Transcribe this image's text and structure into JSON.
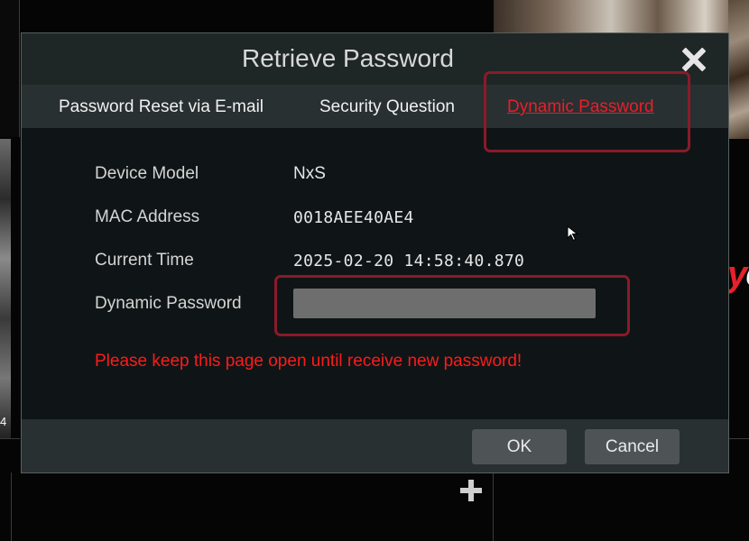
{
  "background": {
    "side_number": "4",
    "brand_fragment_red": "y",
    "brand_fragment_white": "c"
  },
  "dialog": {
    "title": "Retrieve Password",
    "tabs": [
      {
        "label": "Password Reset via E-mail",
        "active": false
      },
      {
        "label": "Security Question",
        "active": false
      },
      {
        "label": "Dynamic Password",
        "active": true
      }
    ],
    "fields": {
      "device_model": {
        "label": "Device Model",
        "value": "NxS"
      },
      "mac_address": {
        "label": "MAC Address",
        "value": "0018AEE40AE4"
      },
      "current_time": {
        "label": "Current Time",
        "value": "2025-02-20 14:58:40.870"
      },
      "dynamic_password": {
        "label": "Dynamic Password",
        "value": ""
      }
    },
    "warning": "Please keep this page open until receive new password!",
    "buttons": {
      "ok": "OK",
      "cancel": "Cancel"
    }
  },
  "colors": {
    "active_tab": "#e81f2b",
    "warning": "#ff1a1a",
    "highlight_box": "#8b1a2a",
    "dialog_bg": "#0f1516"
  },
  "icons": {
    "close": "close-icon",
    "add": "plus-icon",
    "pointer": "cursor-icon"
  }
}
